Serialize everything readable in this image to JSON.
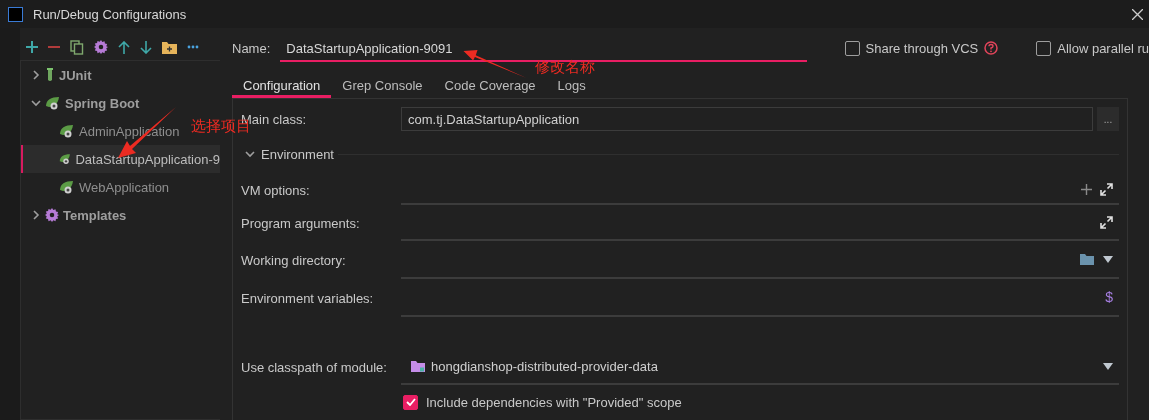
{
  "window": {
    "title": "Run/Debug Configurations"
  },
  "tree": [
    {
      "label": "JUnit",
      "kind": "junit",
      "expanded": false
    },
    {
      "label": "Spring Boot",
      "kind": "spring",
      "expanded": true,
      "children": [
        {
          "label": "AdminApplication",
          "selected": false
        },
        {
          "label": "DataStartupApplication-9",
          "selected": true
        },
        {
          "label": "WebApplication",
          "selected": false
        }
      ]
    },
    {
      "label": "Templates",
      "kind": "templates",
      "expanded": false
    }
  ],
  "name_field": {
    "label": "Name:",
    "value": "DataStartupApplication-9091"
  },
  "options": [
    {
      "label": "Share through VCS",
      "checked": false,
      "help": true
    },
    {
      "label": "Allow parallel ru",
      "checked": false,
      "help": false
    }
  ],
  "tabs": [
    {
      "label": "Configuration",
      "selected": true
    },
    {
      "label": "Grep Console",
      "selected": false
    },
    {
      "label": "Code Coverage",
      "selected": false
    },
    {
      "label": "Logs",
      "selected": false
    }
  ],
  "main_class": {
    "label": "Main class:",
    "value": "com.tj.DataStartupApplication",
    "button": "..."
  },
  "environment": {
    "label": "Environment",
    "expanded": true
  },
  "fields": [
    {
      "label": "VM options:",
      "kind": "vm"
    },
    {
      "label": "Program arguments:",
      "kind": "args"
    },
    {
      "label": "Working directory:",
      "kind": "dir"
    },
    {
      "label": "Environment variables:",
      "kind": "env",
      "button": "$"
    }
  ],
  "module": {
    "label": "Use classpath of module:",
    "value": "hongdianshop-distributed-provider-data"
  },
  "include_provided": {
    "label": "Include dependencies with \"Provided\" scope",
    "checked": true
  },
  "annotations": [
    {
      "text": "修改名称"
    },
    {
      "text": "选择项目"
    }
  ]
}
